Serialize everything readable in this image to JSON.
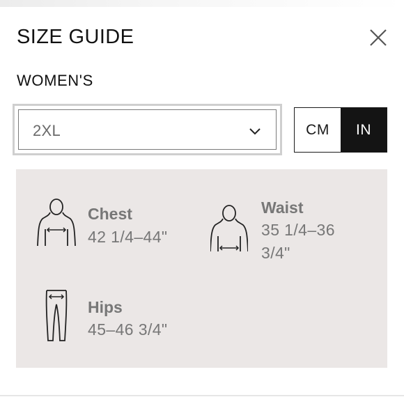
{
  "modal": {
    "title": "SIZE GUIDE",
    "close_icon": "close-icon"
  },
  "section": {
    "title": "WOMEN'S"
  },
  "size_select": {
    "selected": "2XL",
    "icon": "chevron-down-icon"
  },
  "units": {
    "options": [
      "CM",
      "IN"
    ],
    "active": "IN"
  },
  "measurements": [
    {
      "label": "Chest",
      "value": "42 1/4–44\"",
      "icon": "chest-measure-icon"
    },
    {
      "label": "Waist",
      "value": "35 1/4–36 3/4\"",
      "icon": "waist-measure-icon"
    },
    {
      "label": "Hips",
      "value": "45–46 3/4\"",
      "icon": "hips-measure-icon"
    }
  ],
  "colors": {
    "panel_bg": "#ebe7e6",
    "active_toggle": "#141414",
    "measure_text": "#777777"
  }
}
